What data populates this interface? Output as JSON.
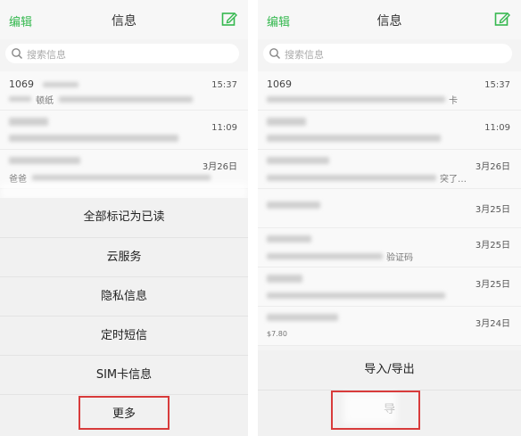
{
  "left": {
    "header": {
      "edit": "编辑",
      "title": "信息",
      "compose_icon": "compose-icon"
    },
    "search": {
      "placeholder": "搜索信息"
    },
    "messages": [
      {
        "sender": "1069",
        "time": "15:37",
        "snippet": "顿纸"
      },
      {
        "sender": "",
        "time": "11:09",
        "snippet": ""
      },
      {
        "sender": "",
        "time": "3月26日",
        "snippet": "爸爸"
      }
    ],
    "sheet": [
      {
        "label": "全部标记为已读"
      },
      {
        "label": "云服务"
      },
      {
        "label": "隐私信息"
      },
      {
        "label": "定时短信"
      },
      {
        "label": "SIM卡信息"
      },
      {
        "label": "更多"
      }
    ]
  },
  "right": {
    "header": {
      "edit": "编辑",
      "title": "信息",
      "compose_icon": "compose-icon"
    },
    "search": {
      "placeholder": "搜索信息"
    },
    "messages": [
      {
        "sender": "1069",
        "time": "15:37",
        "snippet": "卡"
      },
      {
        "sender": "",
        "time": "11:09",
        "snippet": ""
      },
      {
        "sender": "",
        "time": "3月26日",
        "snippet": "突了…"
      },
      {
        "sender": "",
        "time": "3月25日",
        "snippet": ""
      },
      {
        "sender": "",
        "time": "3月25日",
        "snippet": "验证码"
      },
      {
        "sender": "",
        "time": "3月25日",
        "snippet": ""
      },
      {
        "sender": "",
        "time": "3月24日",
        "snippet": "$7.80"
      }
    ],
    "sheet": [
      {
        "label": "导入/导出"
      },
      {
        "label": "导"
      }
    ]
  }
}
